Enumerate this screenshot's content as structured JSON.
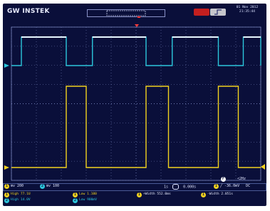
{
  "brand": "GW INSTEK",
  "datetime": {
    "line1": "01 Nov 2012",
    "line2": "21:35:44"
  },
  "colors": {
    "background": "#0a0f3a",
    "grid": "#7d89c4",
    "ch1": "#f2d21f",
    "ch2": "#2cc7dc",
    "ch2_high": "#e8f7ff",
    "stop": "#c41f1f",
    "trigger_marker": "#ff3b3b"
  },
  "channels": {
    "ch1": {
      "tag": "1",
      "scale": "mv 200"
    },
    "ch2": {
      "tag": "2",
      "scale": "mv 100"
    }
  },
  "timebase": {
    "scale": "1s",
    "position": "0.000s"
  },
  "trigger": {
    "tag": "1",
    "source": "F",
    "frequency": "<2Hz",
    "level": "-36.0mV",
    "coupling": "DC"
  },
  "measurements": [
    {
      "tag": "1",
      "channel": "ch1",
      "label": "High 77.1U"
    },
    {
      "tag": "1",
      "channel": "ch1",
      "label": "Low 1.100"
    },
    {
      "tag": "1",
      "channel": "ch1",
      "label": "+Width 552.0ms"
    },
    {
      "tag": "1",
      "channel": "ch1",
      "label": "-Width 2.051s"
    },
    {
      "tag": "2",
      "channel": "ch2",
      "label": "High 14.0V"
    },
    {
      "tag": "2",
      "channel": "ch2",
      "label": "Low 900mV"
    }
  ],
  "waveforms": {
    "ch2_high_segments": [
      [
        0.04,
        0.22
      ],
      [
        0.325,
        0.54
      ],
      [
        0.645,
        0.83
      ],
      [
        0.93,
        1.0
      ]
    ],
    "ch1_pulse_segments": [
      [
        0.22,
        0.3
      ],
      [
        0.54,
        0.63
      ],
      [
        0.83,
        0.91
      ]
    ]
  }
}
